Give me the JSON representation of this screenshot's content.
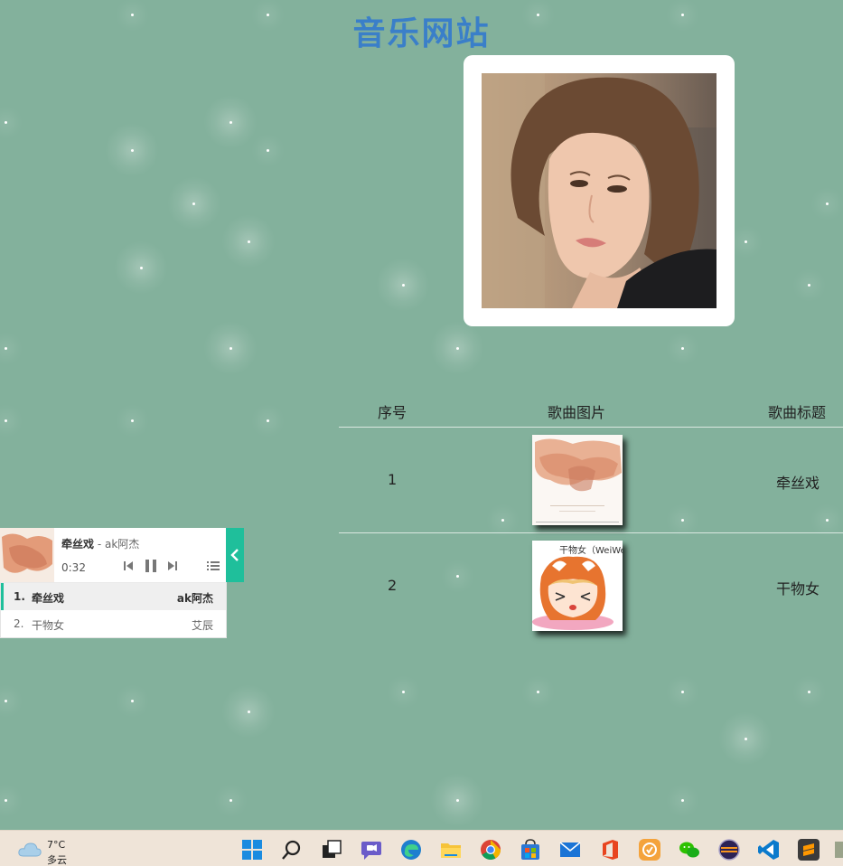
{
  "site": {
    "title": "音乐网站"
  },
  "table": {
    "headers": [
      "序号",
      "歌曲图片",
      "歌曲标题"
    ],
    "rows": [
      {
        "num": "1",
        "title": "牵丝戏"
      },
      {
        "num": "2",
        "title": "干物女",
        "thumb_caption": "干物女（WeiWei）"
      }
    ]
  },
  "player": {
    "title": "牵丝戏",
    "separator": " - ",
    "author": "ak阿杰",
    "time": "0:32",
    "toggle_icon": "chevron-left-icon",
    "playlist": [
      {
        "index": "1.",
        "name": "牵丝戏",
        "author": "ak阿杰",
        "active": true
      },
      {
        "index": "2.",
        "name": "干物女",
        "author": "艾辰",
        "active": false
      }
    ]
  },
  "taskbar": {
    "weather_temp": "7°C",
    "weather_desc": "多云",
    "apps": [
      "windows-start-icon",
      "search-icon",
      "task-view-icon",
      "chat-icon",
      "edge-icon",
      "file-explorer-icon",
      "chrome-icon",
      "store-icon",
      "mail-icon",
      "office-icon",
      "netease-music-icon",
      "wechat-icon",
      "eclipse-icon",
      "vscode-icon",
      "sublime-icon",
      "app-icon"
    ]
  },
  "colors": {
    "background": "#83b19c",
    "title": "#3a7fc9",
    "accent": "#1fbf9b"
  }
}
